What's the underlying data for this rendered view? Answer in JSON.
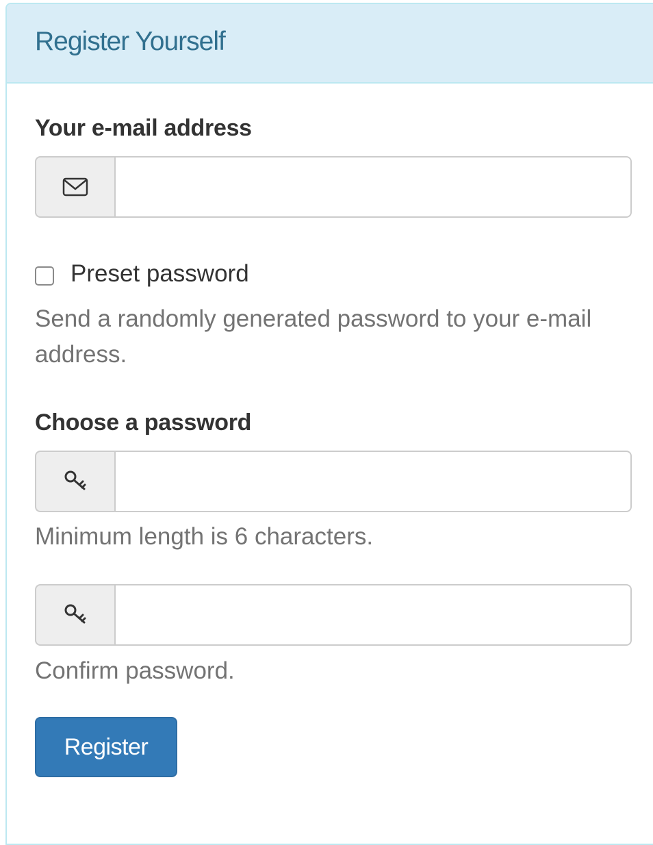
{
  "panel": {
    "title": "Register Yourself"
  },
  "form": {
    "email": {
      "label": "Your e-mail address",
      "value": "",
      "icon": "envelope-icon"
    },
    "preset_password": {
      "label": "Preset password",
      "checked": false,
      "help": "Send a randomly generated password to your e-mail address."
    },
    "password": {
      "label": "Choose a password",
      "value": "",
      "icon": "key-icon",
      "help": "Minimum length is 6 characters."
    },
    "confirm_password": {
      "value": "",
      "icon": "key-icon",
      "help": "Confirm password."
    },
    "submit_label": "Register"
  },
  "colors": {
    "heading_bg": "#d9edf7",
    "heading_text": "#31708f",
    "panel_border": "#bce8f1",
    "primary_button": "#337ab7",
    "addon_bg": "#eeeeee",
    "help_text": "#737373"
  }
}
